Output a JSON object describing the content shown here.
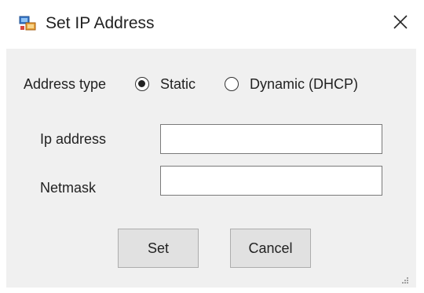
{
  "window": {
    "title": "Set IP Address",
    "icon": "network-adapter-icon",
    "close_icon": "close-icon"
  },
  "address_type": {
    "label": "Address type",
    "options": [
      {
        "label": "Static",
        "selected": true
      },
      {
        "label": "Dynamic (DHCP)",
        "selected": false
      }
    ]
  },
  "fields": {
    "ip_address": {
      "label": "Ip address",
      "value": ""
    },
    "netmask": {
      "label": "Netmask",
      "value": ""
    }
  },
  "buttons": {
    "set_label": "Set",
    "cancel_label": "Cancel"
  }
}
